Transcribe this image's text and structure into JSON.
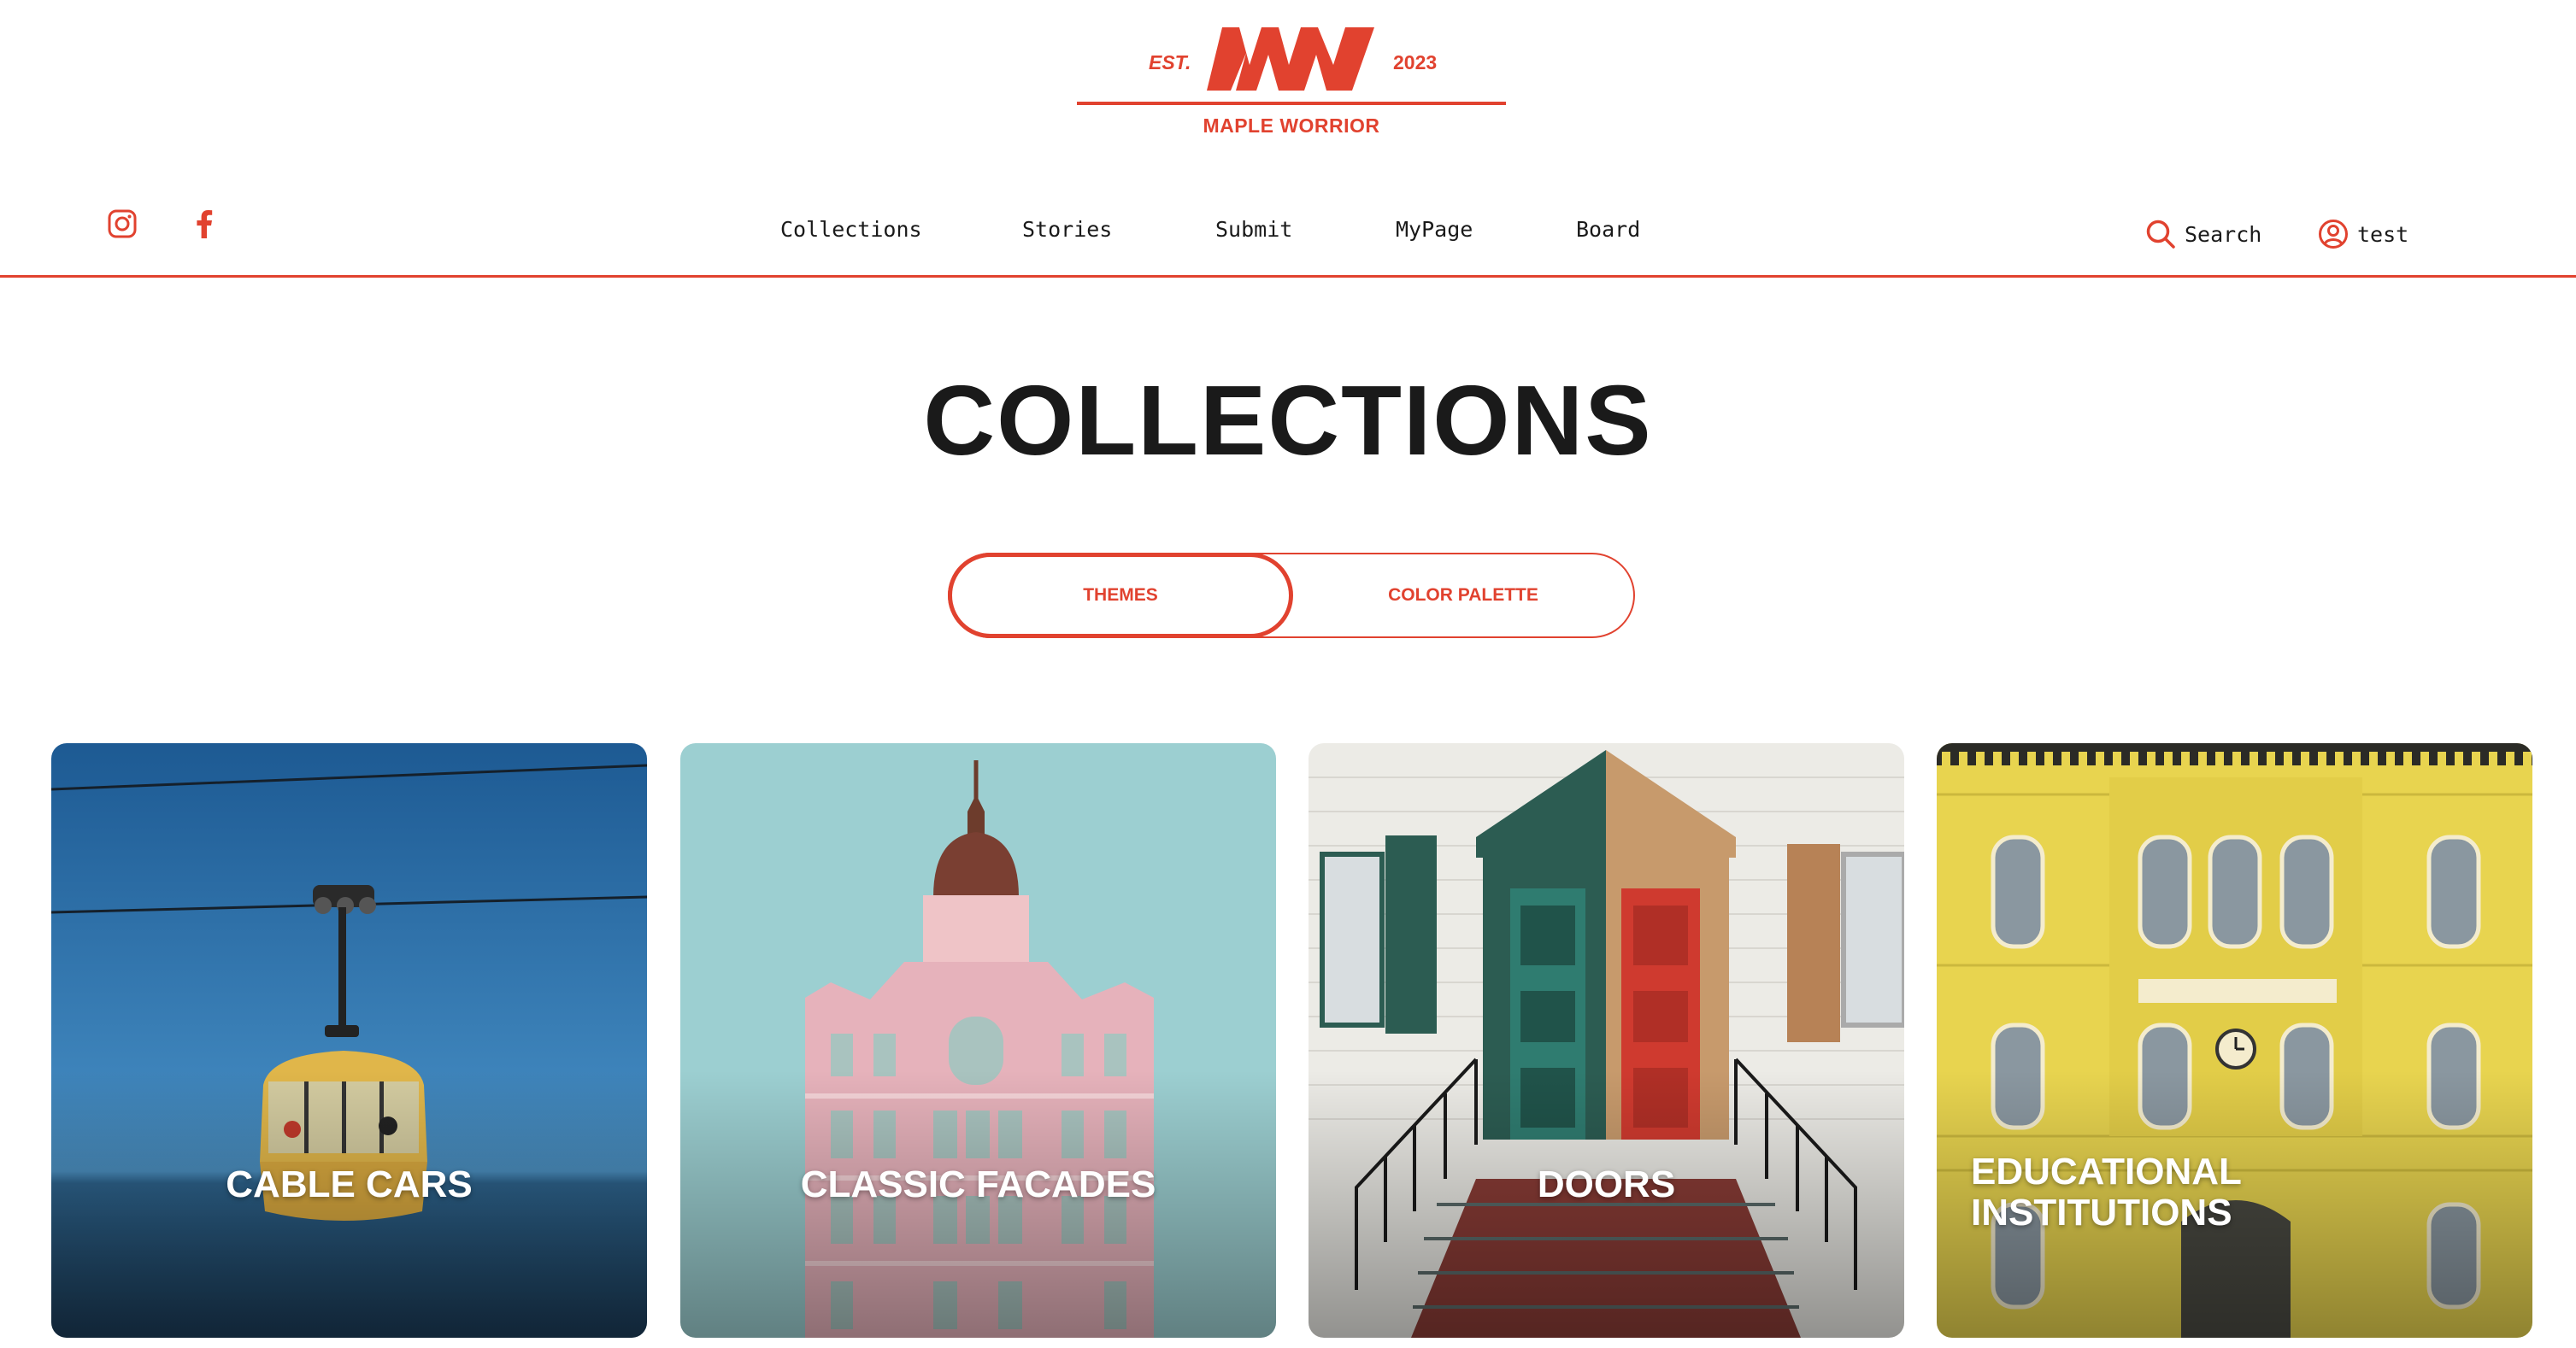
{
  "logo": {
    "est": "EST.",
    "mark": "MW",
    "year": "2023",
    "name": "MAPLE WORRIOR"
  },
  "social": {
    "icons": [
      "instagram-icon",
      "facebook-icon"
    ]
  },
  "nav": {
    "items": [
      "Collections",
      "Stories",
      "Submit",
      "MyPage",
      "Board"
    ]
  },
  "utility": {
    "search_label": "Search",
    "user_label": "test"
  },
  "page": {
    "title": "COLLECTIONS"
  },
  "toggle": {
    "options": [
      "THEMES",
      "COLOR PALETTE"
    ],
    "selected": "THEMES"
  },
  "cards": [
    {
      "label": "CABLE CARS"
    },
    {
      "label": "CLASSIC FACADES"
    },
    {
      "label": "DOORS"
    },
    {
      "label": "EDUCATIONAL INSTITUTIONS",
      "lines": [
        "EDUCATIONAL",
        "INSTITUTIONS"
      ]
    }
  ],
  "colors": {
    "brand": "#e1422f",
    "text": "#1a1a1a",
    "background": "#ffffff"
  }
}
